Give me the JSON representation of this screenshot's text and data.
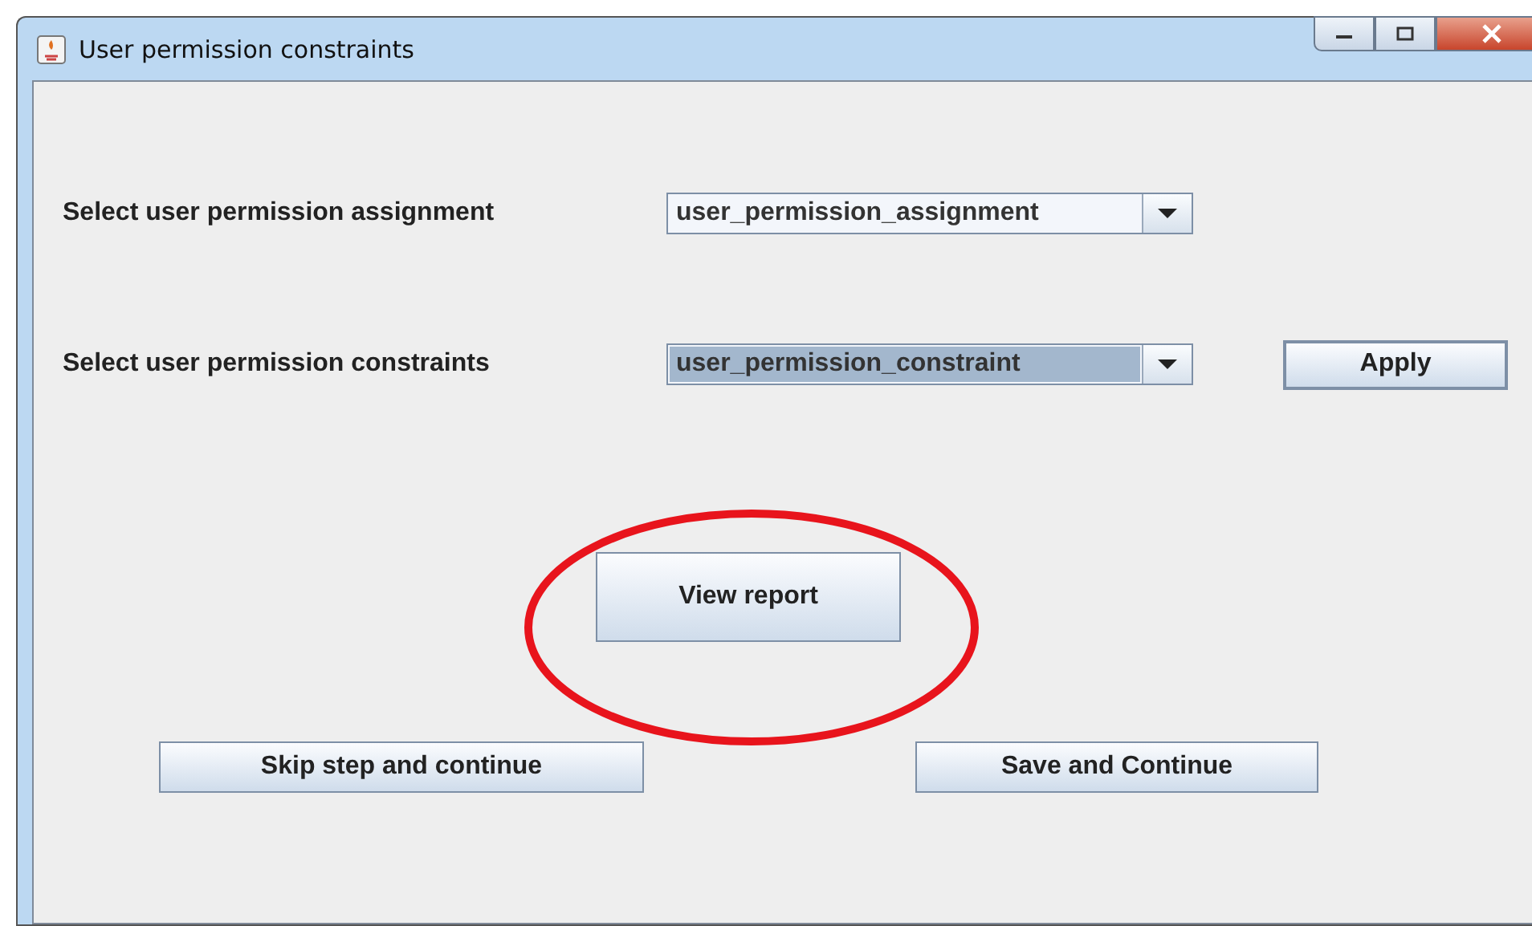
{
  "window": {
    "title": "User permission constraints"
  },
  "rows": [
    {
      "label": "Select user permission assignment",
      "combo": {
        "value": "user_permission_assignment",
        "focused": false
      }
    },
    {
      "label": "Select user permission constraints",
      "combo": {
        "value": "user_permission_constraint",
        "focused": true
      },
      "button": "Apply"
    }
  ],
  "center_button": "View report",
  "annotation": {
    "kind": "ellipse"
  },
  "bottom_buttons": [
    "Skip step and continue",
    "Save and Continue"
  ]
}
